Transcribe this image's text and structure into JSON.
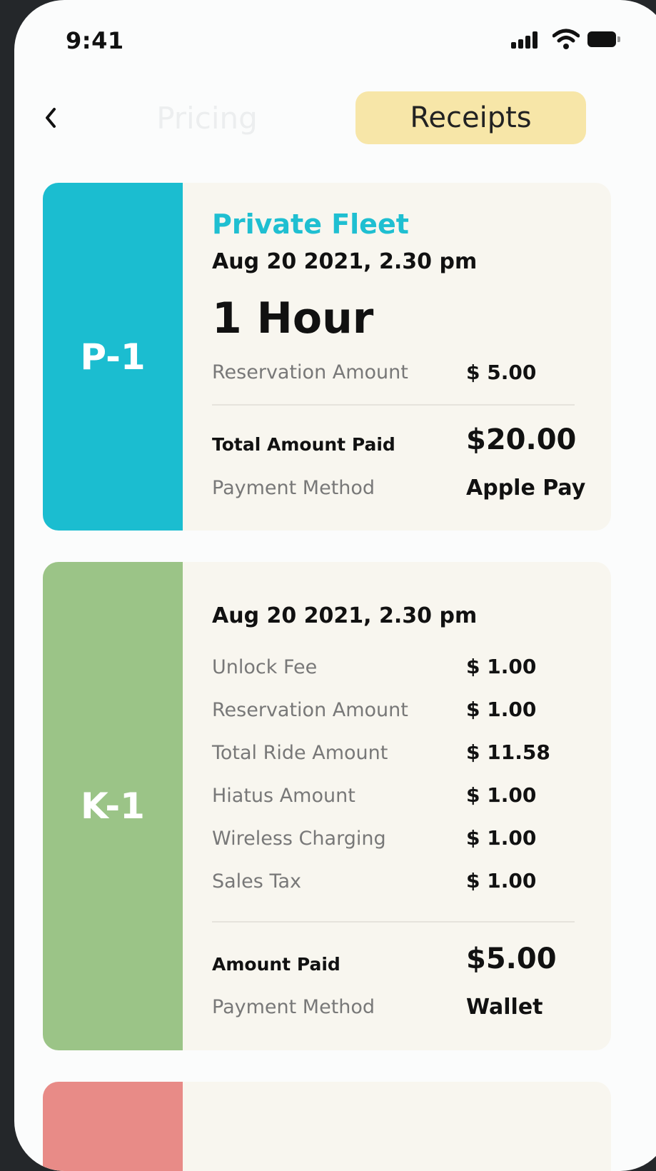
{
  "status_bar": {
    "time": "9:41"
  },
  "header": {
    "tabs": [
      {
        "label": "Pricing",
        "active": false
      },
      {
        "label": "Receipts",
        "active": true
      }
    ]
  },
  "colors": {
    "accent_tab": "#f7e6a8",
    "card_p1": "#1bbdd0",
    "card_k1": "#9bc487",
    "card_third": "#e88b87",
    "card_bg": "#f8f6ef"
  },
  "receipts": [
    {
      "code": "P-1",
      "title": "Private Fleet",
      "date": "Aug 20 2021, 2.30 pm",
      "duration": "1 Hour",
      "items": [
        {
          "label": "Reservation Amount",
          "value": "$ 5.00"
        }
      ],
      "total_label": "Total Amount Paid",
      "total_value": "$20.00",
      "method_label": "Payment Method",
      "method_value": "Apple Pay"
    },
    {
      "code": "K-1",
      "date": "Aug 20 2021, 2.30 pm",
      "items": [
        {
          "label": "Unlock Fee",
          "value": "$ 1.00"
        },
        {
          "label": "Reservation Amount",
          "value": "$ 1.00"
        },
        {
          "label": "Total Ride Amount",
          "value": "$ 11.58"
        },
        {
          "label": "Hiatus Amount",
          "value": "$ 1.00"
        },
        {
          "label": "Wireless Charging",
          "value": "$ 1.00"
        },
        {
          "label": "Sales Tax",
          "value": "$ 1.00"
        }
      ],
      "total_label": "Amount Paid",
      "total_value": "$5.00",
      "method_label": "Payment Method",
      "method_value": "Wallet"
    }
  ]
}
